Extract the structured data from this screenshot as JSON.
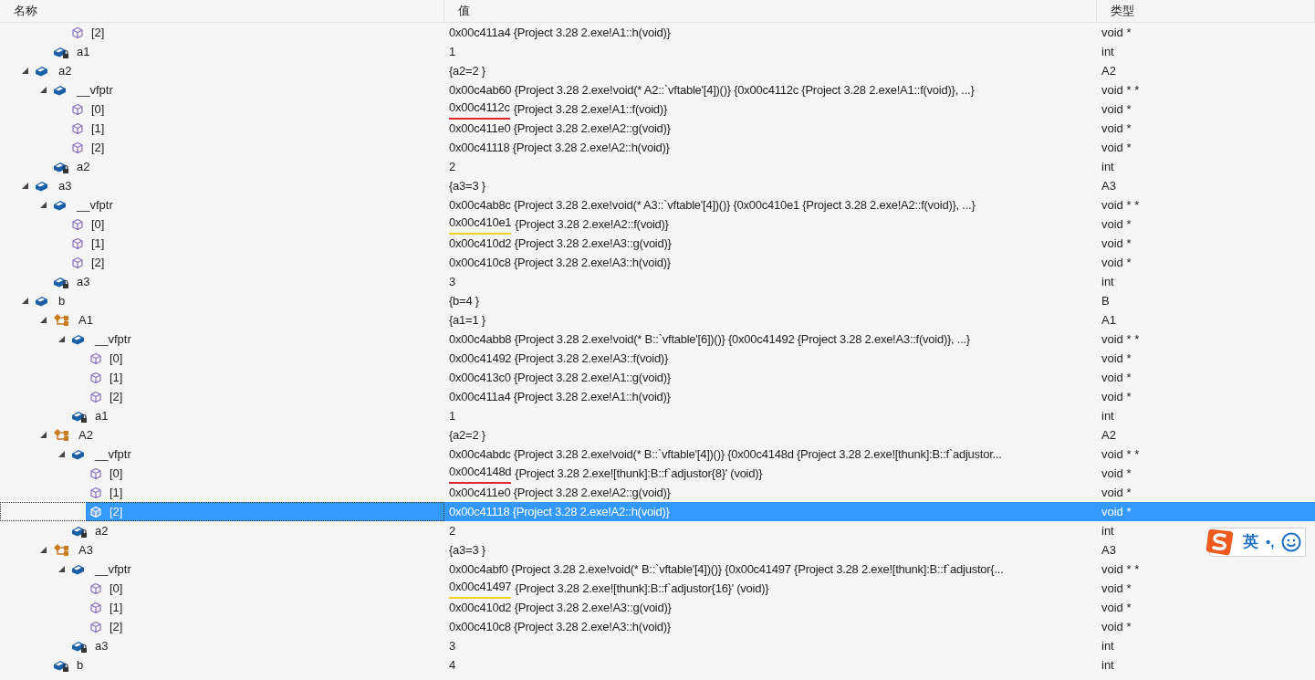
{
  "columns": [
    "名称",
    "值",
    "类型"
  ],
  "rows": [
    {
      "children": [
        {
          "children": [
            {
              "kind": "element",
              "name": "[2]",
              "value": "0x00c411a4 {Project 3.28 2.exe!A1::h(void)}",
              "type": "void *",
              "selected": false
            }
          ]
        },
        {
          "kind": "private",
          "name": "a1",
          "value": "1",
          "type": "int",
          "selected": false
        }
      ]
    },
    {
      "kind": "member",
      "name": "a2",
      "expanded": true,
      "value": "{a2=2 }",
      "type": "A2",
      "selected": false,
      "children": [
        {
          "kind": "member",
          "name": "__vfptr",
          "expanded": true,
          "value": "0x00c4ab60 {Project 3.28 2.exe!void(* A2::`vftable'[4])()} {0x00c4112c {Project 3.28 2.exe!A1::f(void)}, ...}",
          "type": "void * *",
          "selected": false,
          "children": [
            {
              "kind": "element",
              "name": "[0]",
              "address": "0x00c4112c",
              "color": "#e0262b",
              "value": "{Project 3.28 2.exe!A1::f(void)}",
              "type": "void *",
              "selected": false
            },
            {
              "kind": "element",
              "name": "[1]",
              "value": "0x00c411e0 {Project 3.28 2.exe!A2::g(void)}",
              "type": "void *",
              "selected": false
            },
            {
              "kind": "element",
              "name": "[2]",
              "value": "0x00c41118 {Project 3.28 2.exe!A2::h(void)}",
              "type": "void *",
              "selected": false
            }
          ]
        },
        {
          "kind": "private",
          "name": "a2",
          "value": "2",
          "type": "int",
          "selected": false
        }
      ]
    },
    {
      "kind": "member",
      "name": "a3",
      "expanded": true,
      "value": "{a3=3 }",
      "type": "A3",
      "selected": false,
      "children": [
        {
          "kind": "member",
          "name": "__vfptr",
          "expanded": true,
          "value": "0x00c4ab8c {Project 3.28 2.exe!void(* A3::`vftable'[4])()} {0x00c410e1 {Project 3.28 2.exe!A2::f(void)}, ...}",
          "type": "void * *",
          "selected": false,
          "children": [
            {
              "kind": "element",
              "name": "[0]",
              "address": "0x00c410e1",
              "color": "#f2d21b",
              "value": "{Project 3.28 2.exe!A2::f(void)}",
              "type": "void *",
              "selected": false
            },
            {
              "kind": "element",
              "name": "[1]",
              "value": "0x00c410d2 {Project 3.28 2.exe!A3::g(void)}",
              "type": "void *",
              "selected": false
            },
            {
              "kind": "element",
              "name": "[2]",
              "value": "0x00c410c8 {Project 3.28 2.exe!A3::h(void)}",
              "type": "void *",
              "selected": false
            }
          ]
        },
        {
          "kind": "private",
          "name": "a3",
          "value": "3",
          "type": "int",
          "selected": false
        }
      ]
    },
    {
      "kind": "member",
      "name": "b",
      "expanded": true,
      "value": "{b=4 }",
      "type": "B",
      "selected": false,
      "children": [
        {
          "kind": "base",
          "name": "A1",
          "expanded": true,
          "value": "{a1=1 }",
          "type": "A1",
          "selected": false,
          "children": [
            {
              "kind": "member",
              "name": "__vfptr",
              "expanded": true,
              "value": "0x00c4abb8 {Project 3.28 2.exe!void(* B::`vftable'[6])()} {0x00c41492 {Project 3.28 2.exe!A3::f(void)}, ...}",
              "type": "void * *",
              "selected": false,
              "children": [
                {
                  "kind": "element",
                  "name": "[0]",
                  "value": "0x00c41492 {Project 3.28 2.exe!A3::f(void)}",
                  "type": "void *",
                  "selected": false
                },
                {
                  "kind": "element",
                  "name": "[1]",
                  "value": "0x00c413c0 {Project 3.28 2.exe!A1::g(void)}",
                  "type": "void *",
                  "selected": false
                },
                {
                  "kind": "element",
                  "name": "[2]",
                  "value": "0x00c411a4 {Project 3.28 2.exe!A1::h(void)}",
                  "type": "void *",
                  "selected": false
                }
              ]
            },
            {
              "kind": "private",
              "name": "a1",
              "value": "1",
              "type": "int",
              "selected": false
            }
          ]
        },
        {
          "kind": "base",
          "name": "A2",
          "expanded": true,
          "value": "{a2=2 }",
          "type": "A2",
          "selected": false,
          "children": [
            {
              "kind": "member",
              "name": "__vfptr",
              "expanded": true,
              "value": "0x00c4abdc {Project 3.28 2.exe!void(* B::`vftable'[4])()} {0x00c4148d {Project 3.28 2.exe![thunk]:B::f`adjustor...",
              "type": "void * *",
              "selected": false,
              "children": [
                {
                  "kind": "element",
                  "name": "[0]",
                  "address": "0x00c4148d",
                  "color": "#e0262b",
                  "value": "{Project 3.28 2.exe![thunk]:B::f`adjustor{8}' (void)}",
                  "type": "void *",
                  "selected": false
                },
                {
                  "kind": "element",
                  "name": "[1]",
                  "value": "0x00c411e0 {Project 3.28 2.exe!A2::g(void)}",
                  "type": "void *",
                  "selected": false
                },
                {
                  "kind": "element",
                  "name": "[2]",
                  "value": "0x00c41118 {Project 3.28 2.exe!A2::h(void)}",
                  "type": "void *",
                  "selected": true
                }
              ]
            },
            {
              "kind": "private",
              "name": "a2",
              "value": "2",
              "type": "int",
              "selected": false
            }
          ]
        },
        {
          "kind": "base",
          "name": "A3",
          "expanded": true,
          "value": "{a3=3 }",
          "type": "A3",
          "selected": false,
          "children": [
            {
              "kind": "member",
              "name": "__vfptr",
              "expanded": true,
              "value": "0x00c4abf0 {Project 3.28 2.exe!void(* B::`vftable'[4])()} {0x00c41497 {Project 3.28 2.exe![thunk]:B::f`adjustor{...",
              "type": "void * *",
              "selected": false,
              "children": [
                {
                  "kind": "element",
                  "name": "[0]",
                  "address": "0x00c41497",
                  "color": "#f2d21b",
                  "value": "{Project 3.28 2.exe![thunk]:B::f`adjustor{16}' (void)}",
                  "type": "void *",
                  "selected": false
                },
                {
                  "kind": "element",
                  "name": "[1]",
                  "value": "0x00c410d2 {Project 3.28 2.exe!A3::g(void)}",
                  "type": "void *",
                  "selected": false
                },
                {
                  "kind": "element",
                  "name": "[2]",
                  "value": "0x00c410c8 {Project 3.28 2.exe!A3::h(void)}",
                  "type": "void *",
                  "selected": false
                }
              ]
            },
            {
              "kind": "private",
              "name": "a3",
              "value": "3",
              "type": "int",
              "selected": false
            }
          ]
        },
        {
          "kind": "private",
          "name": "b",
          "value": "4",
          "type": "int",
          "selected": false
        }
      ]
    }
  ],
  "ime_bar": {
    "mode": "英",
    "punctuation": "•,"
  }
}
